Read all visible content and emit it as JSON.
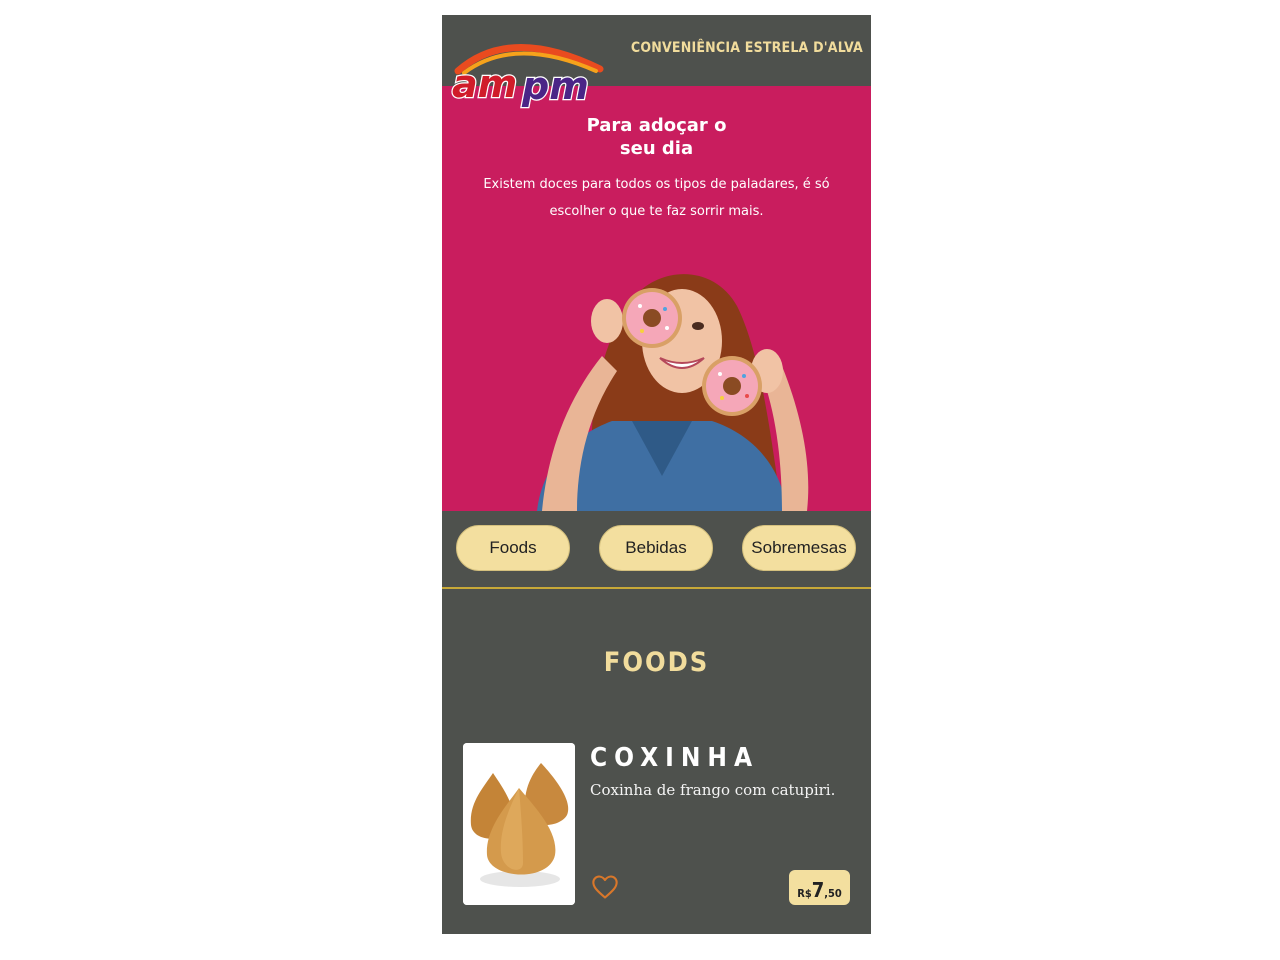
{
  "header": {
    "logo_text": "ampm",
    "store_name": "CONVENIÊNCIA ESTRELA D'ALVA"
  },
  "hero": {
    "title_line1": "Para adoçar o",
    "title_line2": "seu dia",
    "text": "Existem doces para todos os tipos de paladares, é só escolher o que te faz sorrir mais."
  },
  "categories": [
    {
      "label": "Foods"
    },
    {
      "label": "Bebidas"
    },
    {
      "label": "Sobremesas"
    }
  ],
  "section": {
    "title": "FOODS"
  },
  "products": [
    {
      "name": "COXINHA",
      "description": "Coxinha de frango com catupiri.",
      "price_currency": "R$",
      "price_int": "7",
      "price_dec": ",50",
      "favorite_icon": "heart-outline-icon"
    }
  ],
  "colors": {
    "background": "#4e514d",
    "hero": "#c91d5e",
    "accent": "#f3df9f",
    "accent_text": "#f1dc9c"
  }
}
